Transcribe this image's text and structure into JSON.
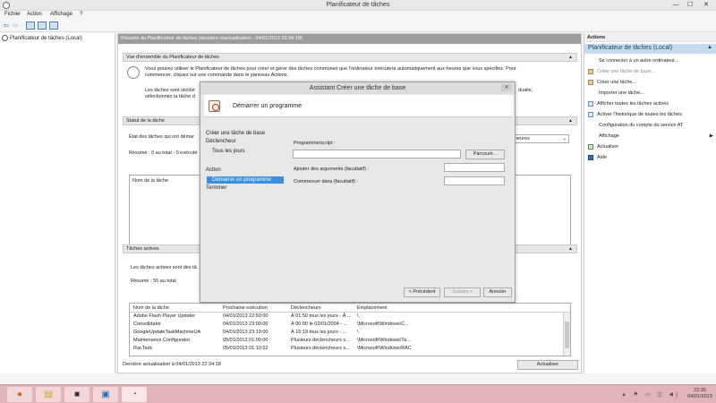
{
  "window": {
    "title": "Planificateur de tâches",
    "min": "—",
    "max": "☐",
    "close": "✕"
  },
  "menu": [
    "Fichier",
    "Action",
    "Affichage",
    "?"
  ],
  "toolbar": {
    "back": "⇦",
    "forward": "⇨"
  },
  "tree": {
    "root": "Planificateur de tâches (Local)"
  },
  "main": {
    "header": "Résumé du Planificateur de tâches (dernière réactualisation : 04/01/2013 22:34:18)",
    "overview": {
      "title": "Vue d'ensemble du Planificateur de tâches",
      "line1": "Vous pouvez utiliser le Planificateur de tâches pour créer et gérer des tâches communes que l'ordinateur exécutera automatiquement aux heures que vous spécifiez. Pour",
      "line2": "commencer, cliquez sur une commande dans le panneau Actions.",
      "line3": "Les tâches sont stocké",
      "line3b": "dualle,",
      "line4": "sélectionnez la tâche d"
    },
    "status": {
      "title": "Statut de la tâche",
      "state_label": "État des tâches qui ont démar",
      "combo": "heures",
      "summary": "Résumé : 0 au total - 0 exécuté",
      "col_name": "Nom de la tâche"
    },
    "active": {
      "title": "Tâches actives",
      "desc": "Les tâches actives sont des tâ",
      "summary": "Résumé : 55 au total",
      "columns": [
        "Nom de la tâche",
        "Prochaine exécution",
        "Déclencheurs",
        "Emplacement"
      ],
      "rows": [
        [
          "Adobe Flash Player Updater",
          "04/01/2013 22:50:00",
          "À 01:50 tous les jours - À ...",
          "\\"
        ],
        [
          "Consolidator",
          "04/01/2013 23:00:00",
          "À 00:00 le 02/01/2004 - ...",
          "\\Microsoft\\Windows\\C..."
        ],
        [
          "GoogleUpdateTaskMachineUA",
          "04/01/2013 23:19:00",
          "À 15:19 tous les jours - ...",
          "\\"
        ],
        [
          "Maintenance Configurator",
          "05/01/2013 01:00:00",
          "Plusieurs déclencheurs s...",
          "\\Microsoft\\Windows\\Ta..."
        ],
        [
          "RacTask",
          "05/01/2013 01:10:52",
          "Plusieurs déclencheurs s...",
          "\\Microsoft\\Windows\\RAC"
        ]
      ]
    },
    "last_update": "Dernière actualisation à 04/01/2013 22:34:18",
    "refresh_button": "Actualiser"
  },
  "actions": {
    "header": "Actions",
    "subheader": "Planificateur de tâches (Local)",
    "items": [
      {
        "label": "Se connecter à un autre ordinateur...",
        "icon": "none"
      },
      {
        "label": "Créer une tâche de base...",
        "icon": "task-basic-icon"
      },
      {
        "label": "Créer une tâche...",
        "icon": "task-create-icon"
      },
      {
        "label": "Importer une tâche...",
        "icon": "none"
      },
      {
        "label": "Afficher toutes les tâches actives",
        "icon": "list-icon"
      },
      {
        "label": "Activer l'historique de toutes les tâches",
        "icon": "history-icon"
      },
      {
        "label": "Configuration du compte du service AT",
        "icon": "none"
      },
      {
        "label": "Affichage",
        "icon": "none"
      },
      {
        "label": "Actualiser",
        "icon": "refresh-icon"
      },
      {
        "label": "Aide",
        "icon": "help-icon"
      }
    ],
    "submenu_arrow": "▶"
  },
  "dialog": {
    "title": "Assistant Créer une tâche de base",
    "close": "✕",
    "heading": "Démarrer un programme",
    "steps": [
      "Créer une tâche de base",
      "Déclencheur",
      "Tous les jours",
      "Action",
      "Démarrer un programme",
      "Terminer"
    ],
    "program_label": "Programme/script :",
    "browse_button": "Parcourir...",
    "args_label": "Ajouter des arguments (facultatif) :",
    "startin_label": "Commencer dans (facultatif) :",
    "prev_button": "< Précédent",
    "next_button": "Suivant >",
    "cancel_button": "Annuler"
  },
  "taskbar": {
    "time": "22:35",
    "date": "04/01/2013",
    "tray_icons": "▲ ⚑ ▭ ◫ ◀)"
  },
  "colors": {
    "accent": "#3c8ee0",
    "actions_header_bg": "#c7dcf1",
    "taskbar_bg": "#e2b3b9",
    "mid_header_bg": "#9d9d9d"
  }
}
